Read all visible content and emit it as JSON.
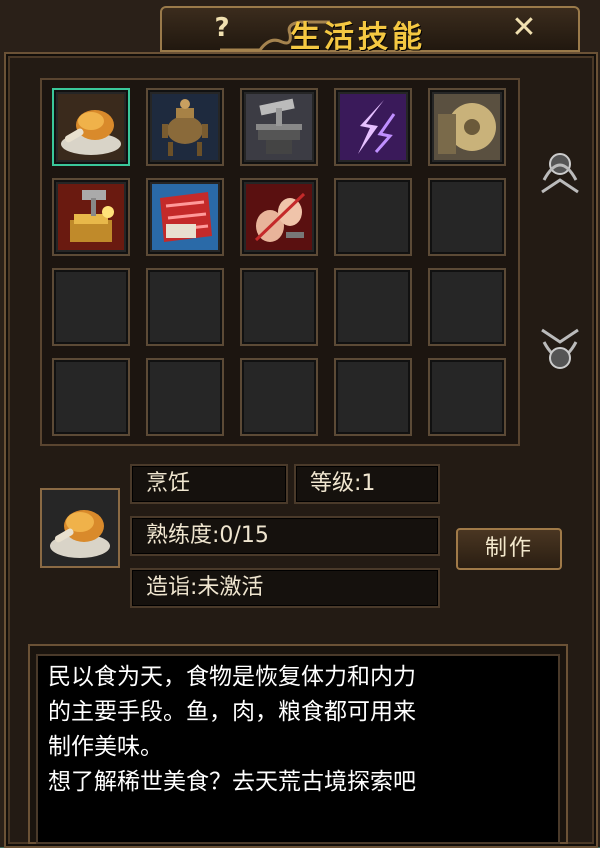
{
  "window": {
    "title": "生活技能",
    "help_label": "?",
    "close_label": "✕"
  },
  "skills": [
    {
      "icon": "roast-chicken-icon",
      "selected": true
    },
    {
      "icon": "bronze-censer-icon"
    },
    {
      "icon": "anvil-hammer-icon"
    },
    {
      "icon": "purple-lightning-icon"
    },
    {
      "icon": "grindstone-icon"
    },
    {
      "icon": "gold-ingot-hammer-icon"
    },
    {
      "icon": "red-cloth-icon"
    },
    {
      "icon": "needle-sewing-icon"
    }
  ],
  "total_slots": 20,
  "info": {
    "skill_name": "烹饪",
    "level": "等级:1",
    "proficiency": "熟练度:0/15",
    "attainment": "造诣:未激活",
    "make_button": "制作"
  },
  "description": {
    "line1": "民以食为天，食物是恢复体力和内力",
    "line2": "的主要手段。鱼，肉，粮食都可用来",
    "line3": "制作美味。",
    "line4": "想了解稀世美食？去天荒古境探索吧"
  }
}
